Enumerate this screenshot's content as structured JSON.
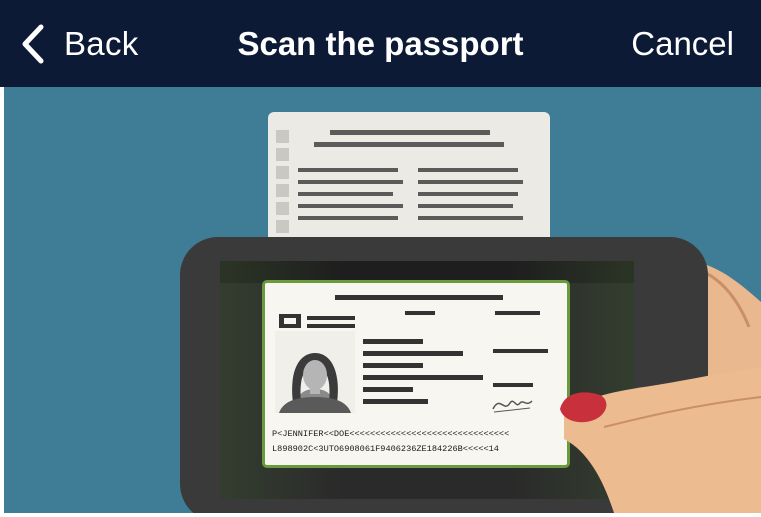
{
  "navbar": {
    "back_label": "Back",
    "title": "Scan the passport",
    "cancel_label": "Cancel",
    "back_icon": "chevron-left-icon"
  },
  "illustration": {
    "background_color": "#3f7d96",
    "mrz_line_1": "P<JENNIFER<<DOE<<<<<<<<<<<<<<<<<<<<<<<<<<<<<<<",
    "mrz_line_2": "L898902C<3UTO6908061F9406236ZE184226B<<<<<14"
  },
  "colors": {
    "navbar": "#0d1a35",
    "scan_frame": "#6a9a3e",
    "nail": "#c8303c"
  }
}
